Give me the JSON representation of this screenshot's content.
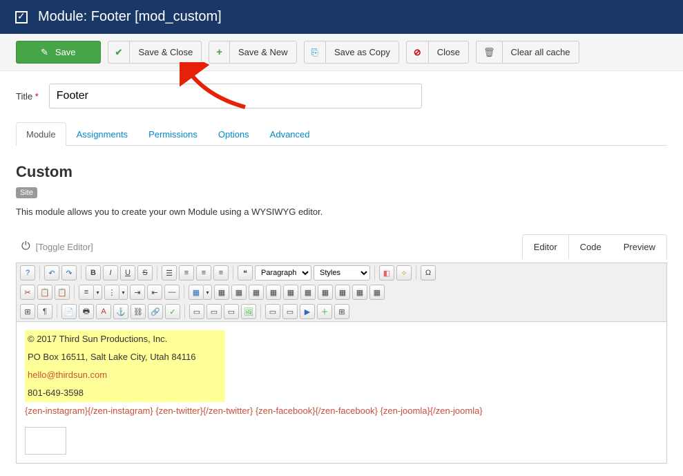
{
  "header": {
    "title": "Module: Footer [mod_custom]"
  },
  "toolbar": {
    "save": "Save",
    "save_close": "Save & Close",
    "save_new": "Save & New",
    "save_copy": "Save as Copy",
    "close": "Close",
    "clear_cache": "Clear all cache"
  },
  "title_field": {
    "label": "Title",
    "req": "*",
    "value": "Footer"
  },
  "tabs": [
    "Module",
    "Assignments",
    "Permissions",
    "Options",
    "Advanced"
  ],
  "module": {
    "heading": "Custom",
    "badge": "Site",
    "description": "This module allows you to create your own Module using a WYSIWYG editor."
  },
  "editor": {
    "toggle": "[Toggle Editor]",
    "tabs": [
      "Editor",
      "Code",
      "Preview"
    ],
    "format_select": "Paragraph",
    "styles_select": "Styles"
  },
  "content": {
    "line1": "© 2017 Third Sun Productions, Inc.",
    "line2": "PO Box 16511, Salt Lake City, Utah 84116",
    "email": "hello@thirdsun.com",
    "phone": "801-649-3598",
    "shortcodes": "{zen-instagram}{/zen-instagram} {zen-twitter}{/zen-twitter} {zen-facebook}{/zen-facebook} {zen-joomla}{/zen-joomla}"
  }
}
